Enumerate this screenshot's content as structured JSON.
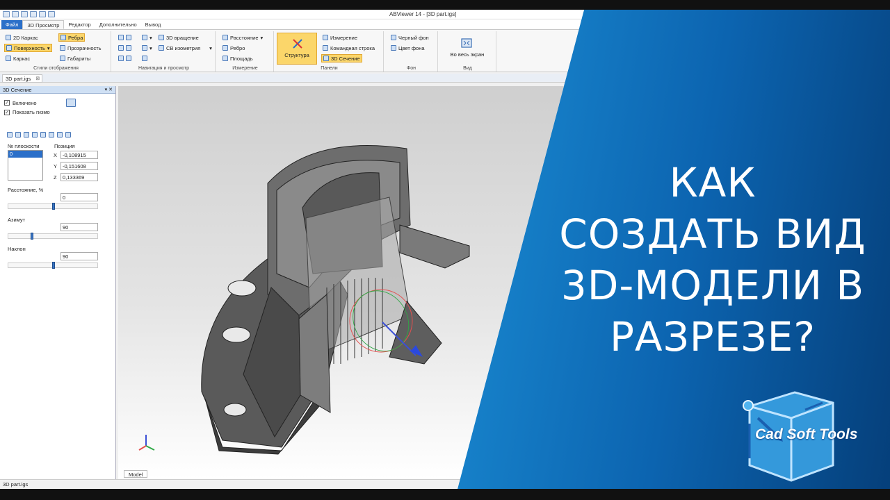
{
  "app": {
    "title": "ABViewer 14 - [3D part.igs]",
    "tabs": [
      "Файл",
      "3D Просмотр",
      "Редактор",
      "Дополнительно",
      "Вывод"
    ]
  },
  "ribbon": {
    "display_styles": {
      "label": "Стили отображения",
      "wireframe_2d": "2D Каркас",
      "edges": "Ребра",
      "surface": "Поверхность",
      "transparency": "Прозрачность",
      "wireframe": "Каркас",
      "dimensions": "Габариты"
    },
    "navigation": {
      "label": "Навигация и просмотр",
      "rotation_3d": "3D вращение",
      "iso_view": "СВ изометрия"
    },
    "measure": {
      "label": "Измерение",
      "distance": "Расстояние",
      "edge": "Ребро",
      "area": "Площадь"
    },
    "panels": {
      "label": "Панели",
      "structure": "Структура",
      "measurement": "Измерение",
      "command_line": "Командная строка",
      "section_3d": "3D Сечение"
    },
    "background": {
      "label": "Фон",
      "black": "Черный фон",
      "color": "Цвет фона"
    },
    "view": {
      "label": "Вид",
      "fullscreen": "Во весь экран"
    }
  },
  "document_tab": "3D part.igs",
  "section_panel": {
    "title": "3D Сечение",
    "enabled_label": "Включено",
    "show_gizmo_label": "Показать гизмо",
    "plane_no_label": "№ плоскости",
    "plane_item": "0",
    "position_label": "Позиция",
    "x_label": "X",
    "y_label": "Y",
    "z_label": "Z",
    "x": "-0,108915",
    "y": "-0,151608",
    "z": "0,133369",
    "distance_label": "Расстояние, %",
    "distance": "0",
    "azimuth_label": "Азимут",
    "azimuth": "90",
    "tilt_label": "Наклон",
    "tilt": "90",
    "distance_slider_level": 0.5,
    "azimuth_slider_level": 0.25,
    "tilt_slider_level": 0.5
  },
  "viewport": {
    "model_tab": "Model"
  },
  "status": {
    "file": "3D part.igs"
  },
  "headline": [
    "КАК",
    "СОЗДАТЬ ВИД",
    "3D-МОДЕЛИ В",
    "РАЗРЕЗЕ?"
  ],
  "logo": {
    "text": "Cad Soft Tools"
  },
  "colors": {
    "ribbon_selected": "#fbd66a",
    "file_tab": "#2b70c9",
    "background_blue": "#1e96dc"
  }
}
